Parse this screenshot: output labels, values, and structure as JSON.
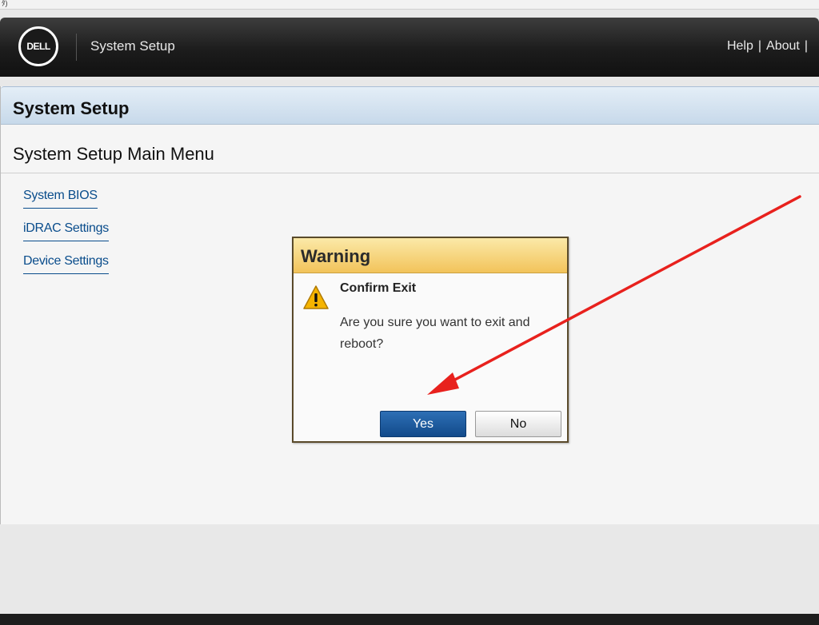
{
  "header": {
    "logo_text": "DELL",
    "title": "System Setup",
    "links": [
      "Help",
      "About"
    ],
    "trailing_sep": "|"
  },
  "section": {
    "title": "System Setup"
  },
  "main_menu": {
    "title": "System Setup Main Menu",
    "items": [
      {
        "label": "System BIOS"
      },
      {
        "label": "iDRAC Settings"
      },
      {
        "label": "Device Settings"
      }
    ]
  },
  "dialog": {
    "title": "Warning",
    "icon": "warning-triangle-icon",
    "heading": "Confirm Exit",
    "message": "Are you sure you want to exit and reboot?",
    "yes_label": "Yes",
    "no_label": "No"
  },
  "colors": {
    "accent_blue": "#124a8a",
    "link_blue": "#0a4d8c",
    "warning_yellow": "#f2c35a",
    "annotation_red": "#e8211d"
  }
}
